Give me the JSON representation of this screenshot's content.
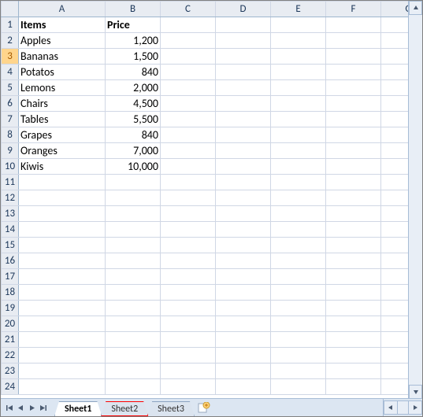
{
  "columns": [
    "A",
    "B",
    "C",
    "D",
    "E",
    "F",
    "G"
  ],
  "rows": [
    1,
    2,
    3,
    4,
    5,
    6,
    7,
    8,
    9,
    10,
    11,
    12,
    13,
    14,
    15,
    16,
    17,
    18,
    19,
    20,
    21,
    22,
    23,
    24
  ],
  "selected_row": 3,
  "headers": {
    "A": "Items",
    "B": "Price"
  },
  "data": [
    {
      "item": "Apples",
      "price": "1,200"
    },
    {
      "item": "Bananas",
      "price": "1,500"
    },
    {
      "item": "Potatos",
      "price": "840"
    },
    {
      "item": "Lemons",
      "price": "2,000"
    },
    {
      "item": "Chairs",
      "price": "4,500"
    },
    {
      "item": "Tables",
      "price": "5,500"
    },
    {
      "item": "Grapes",
      "price": "840"
    },
    {
      "item": "Oranges",
      "price": "7,000"
    },
    {
      "item": "Kiwis",
      "price": "10,000"
    }
  ],
  "tabs": [
    {
      "label": "Sheet1",
      "active": true,
      "highlight": false
    },
    {
      "label": "Sheet2",
      "active": false,
      "highlight": true
    },
    {
      "label": "Sheet3",
      "active": false,
      "highlight": false
    }
  ],
  "chart_data": {
    "type": "table",
    "columns": [
      "Items",
      "Price"
    ],
    "rows": [
      [
        "Apples",
        1200
      ],
      [
        "Bananas",
        1500
      ],
      [
        "Potatos",
        840
      ],
      [
        "Lemons",
        2000
      ],
      [
        "Chairs",
        4500
      ],
      [
        "Tables",
        5500
      ],
      [
        "Grapes",
        840
      ],
      [
        "Oranges",
        7000
      ],
      [
        "Kiwis",
        10000
      ]
    ]
  }
}
